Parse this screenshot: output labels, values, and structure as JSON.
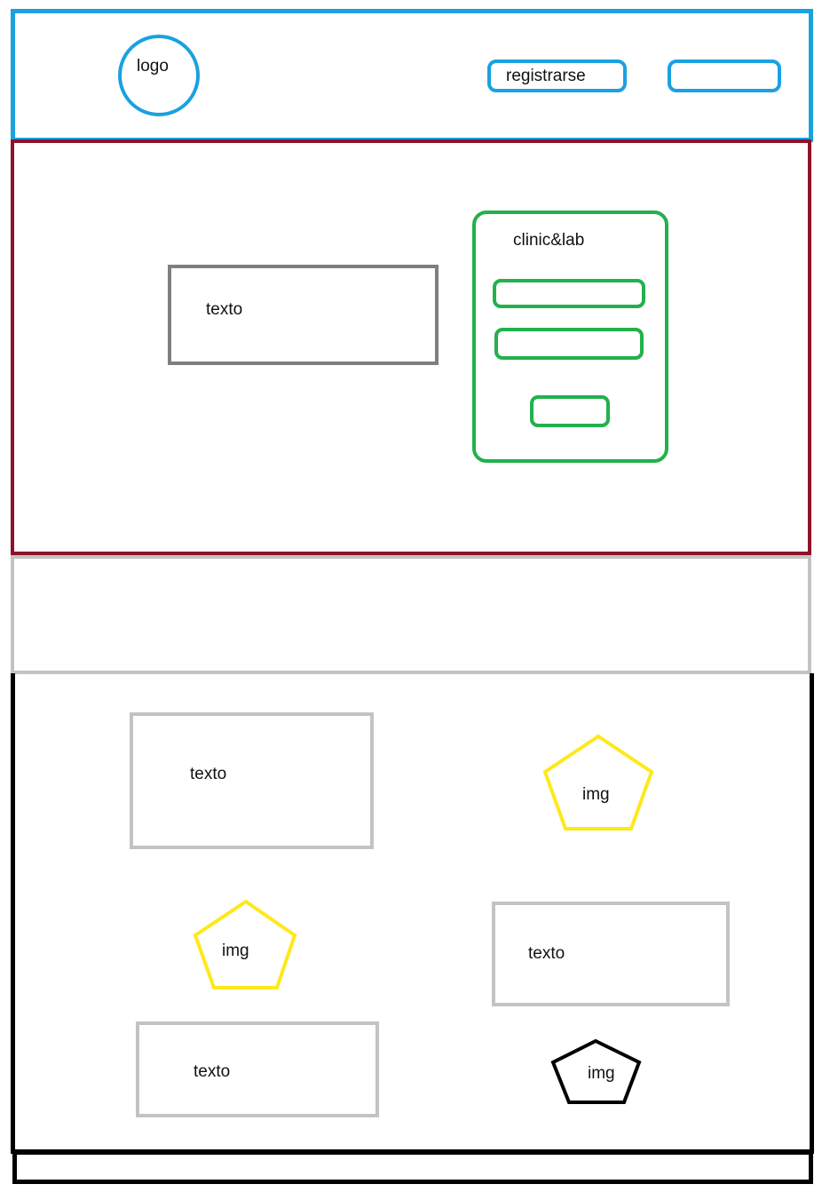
{
  "header": {
    "logo_label": "logo",
    "register_label": "registrarse",
    "second_button_label": ""
  },
  "hero": {
    "text_label": "texto",
    "login_card": {
      "title": "clinic&lab"
    }
  },
  "content": {
    "text_blocks": [
      "texto",
      "texto",
      "texto"
    ],
    "images": [
      "img",
      "img",
      "img"
    ]
  },
  "colors": {
    "header": "#1aa1e0",
    "hero": "#8e1229",
    "login_card": "#22b14c",
    "text_box": "#c3c3c3",
    "hero_text_box": "#7f7f7f",
    "image_placeholder": "#ffe81a",
    "content": "#000000"
  }
}
